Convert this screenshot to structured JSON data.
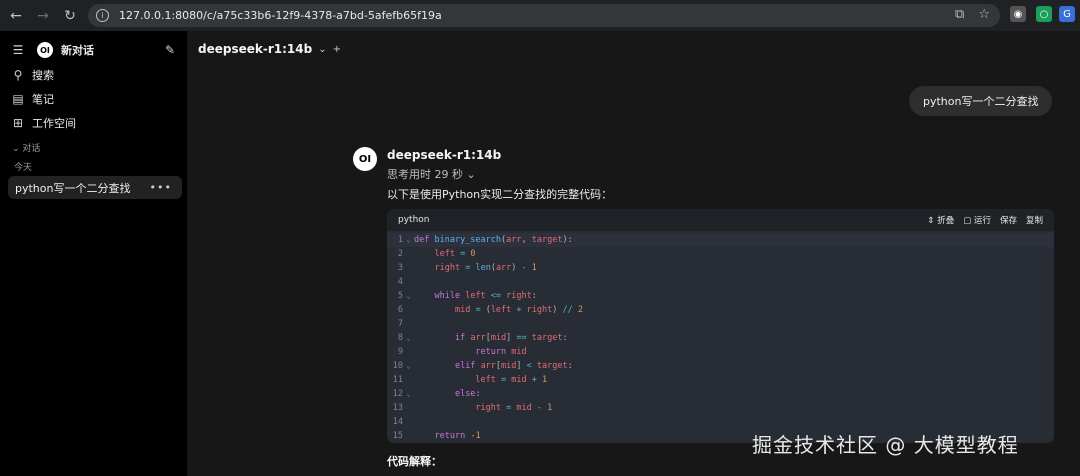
{
  "browser": {
    "url": "127.0.0.1:8080/c/a75c33b6-12f9-4378-a7bd-5afefb65f19a",
    "icons": [
      "back-icon",
      "forward-icon",
      "reload-icon",
      "site-info-icon",
      "install-icon",
      "bookmark-star-icon"
    ]
  },
  "sidebar": {
    "new_chat": "新对话",
    "logo": "OI",
    "items": [
      {
        "label": "搜索",
        "icon": "search-icon"
      },
      {
        "label": "笔记",
        "icon": "notes-icon"
      },
      {
        "label": "工作空间",
        "icon": "workspace-icon"
      }
    ],
    "section": "对话",
    "group": "今天",
    "conversation": "python写一个二分查找",
    "conversation_menu": "•••"
  },
  "main": {
    "model": "deepseek-r1:14b",
    "user_message": "python写一个二分查找",
    "response": {
      "avatar": "OI",
      "model_name": "deepseek-r1:14b",
      "thinking": "思考用时 29 秒",
      "intro": "以下是使用Python实现二分查找的完整代码：",
      "code": {
        "lang": "python",
        "actions": [
          "折叠",
          "运行",
          "保存",
          "复制"
        ],
        "lines": [
          {
            "n": "1",
            "fold": true,
            "text": "def binary_search(arr, target):"
          },
          {
            "n": "2",
            "fold": false,
            "text": "    left = 0"
          },
          {
            "n": "3",
            "fold": false,
            "text": "    right = len(arr) - 1"
          },
          {
            "n": "4",
            "fold": false,
            "text": ""
          },
          {
            "n": "5",
            "fold": true,
            "text": "    while left <= right:"
          },
          {
            "n": "6",
            "fold": false,
            "text": "        mid = (left + right) // 2"
          },
          {
            "n": "7",
            "fold": false,
            "text": ""
          },
          {
            "n": "8",
            "fold": true,
            "text": "        if arr[mid] == target:"
          },
          {
            "n": "9",
            "fold": false,
            "text": "            return mid"
          },
          {
            "n": "10",
            "fold": true,
            "text": "        elif arr[mid] < target:"
          },
          {
            "n": "11",
            "fold": false,
            "text": "            left = mid + 1"
          },
          {
            "n": "12",
            "fold": true,
            "text": "        else:"
          },
          {
            "n": "13",
            "fold": false,
            "text": "            right = mid - 1"
          },
          {
            "n": "14",
            "fold": false,
            "text": ""
          },
          {
            "n": "15",
            "fold": false,
            "text": "    return -1"
          }
        ]
      },
      "explain_heading": "代码解释："
    }
  },
  "watermark": "掘金技术社区 @ 大模型教程"
}
